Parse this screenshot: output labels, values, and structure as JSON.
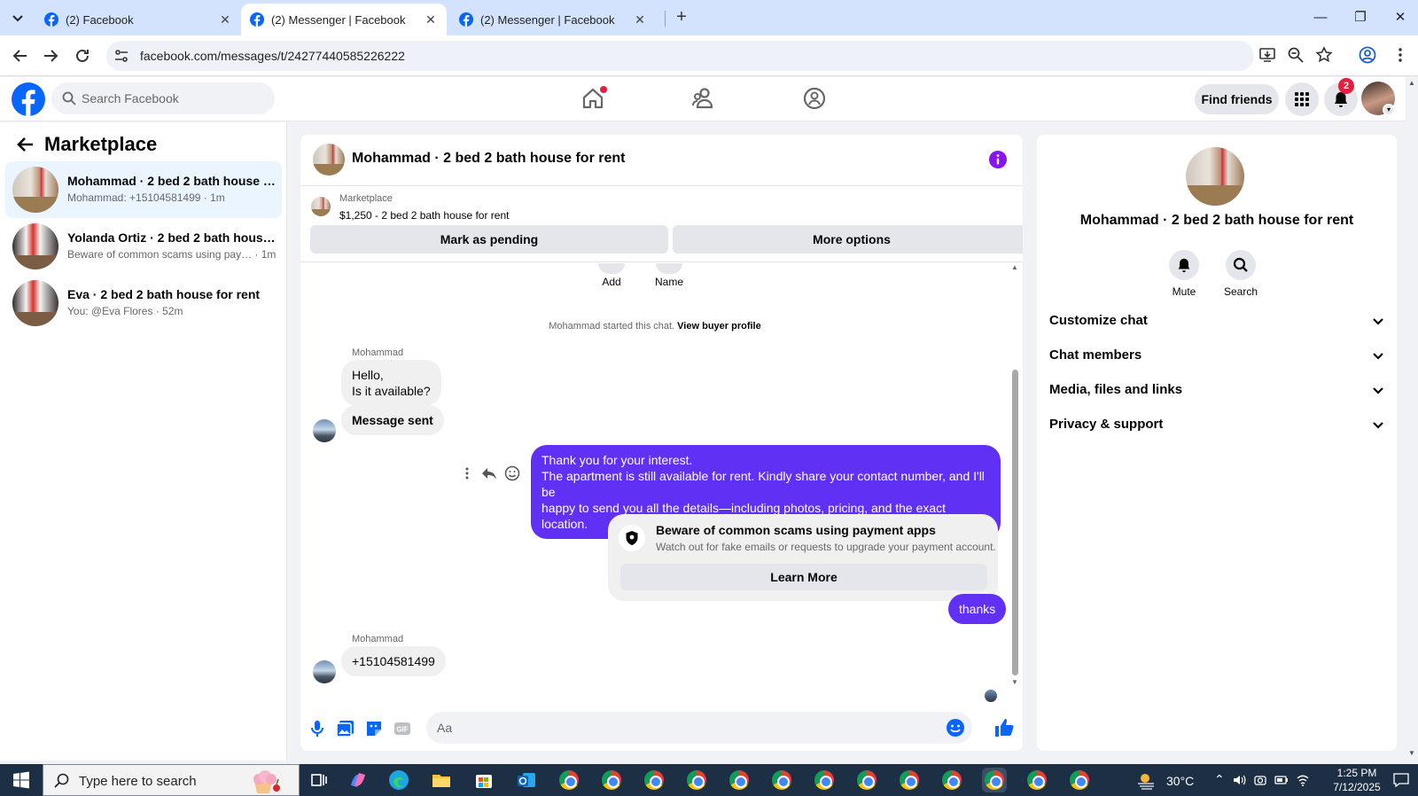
{
  "browser": {
    "tabs": [
      {
        "title": "(2) Facebook",
        "active": false
      },
      {
        "title": "(2) Messenger | Facebook",
        "active": true
      },
      {
        "title": "(2) Messenger | Facebook",
        "active": false
      }
    ],
    "url": "facebook.com/messages/t/24277440585226222"
  },
  "fb_header": {
    "search_placeholder": "Search Facebook",
    "find_friends": "Find friends",
    "notification_count": "2"
  },
  "sidebar": {
    "title": "Marketplace",
    "conversations": [
      {
        "title": "Mohammad · 2 bed 2 bath house for rent",
        "subtitle": "Mohammad: +15104581499 · 1m",
        "selected": true
      },
      {
        "title": "Yolanda Ortiz · 2 bed 2 bath house for rent",
        "subtitle": "Beware of common scams using pay… · 1m",
        "selected": false
      },
      {
        "title": "Eva · 2 bed 2 bath house for rent",
        "subtitle": "You: @Eva Flores · 52m",
        "selected": false
      }
    ]
  },
  "chat": {
    "title": "Mohammad · 2 bed 2 bath house for rent",
    "listing": {
      "label": "Marketplace",
      "price_title": "$1,250 - 2 bed 2 bath house for rent",
      "mark_pending": "Mark as pending",
      "more_options": "More options"
    },
    "quick_actions": {
      "add": "Add",
      "name": "Name"
    },
    "system_message": "Mohammad started this chat.",
    "system_link": "View buyer profile",
    "messages": {
      "sender_1": "Mohammad",
      "msg_1_line1": "Hello,",
      "msg_1_line2": "Is it available?",
      "msg_2": "Message sent",
      "out_1_line1": "Thank you for your interest.",
      "out_1_line2": "The apartment is still available for rent. Kindly share your contact number, and I'll be",
      "out_1_line3": "happy to send you all the details—including photos, pricing, and the exact location.",
      "out_2": "thanks",
      "sender_2": "Mohammad",
      "msg_3": "+15104581499"
    },
    "scam_card": {
      "title": "Beware of common scams using payment apps",
      "subtitle": "Watch out for fake emails or requests to upgrade your payment account.",
      "button": "Learn More"
    },
    "composer_placeholder": "Aa"
  },
  "right_panel": {
    "title": "Mohammad · 2 bed 2 bath house for rent",
    "mute": "Mute",
    "search": "Search",
    "sections": [
      "Customize chat",
      "Chat members",
      "Media, files and links",
      "Privacy & support"
    ]
  },
  "taskbar": {
    "search_placeholder": "Type here to search",
    "weather": "30°C",
    "time": "1:25 PM",
    "date": "7/12/2025"
  },
  "colors": {
    "fb_blue": "#0866ff",
    "outgoing_bubble": "#6030f5",
    "notification_red": "#e41e3f"
  }
}
